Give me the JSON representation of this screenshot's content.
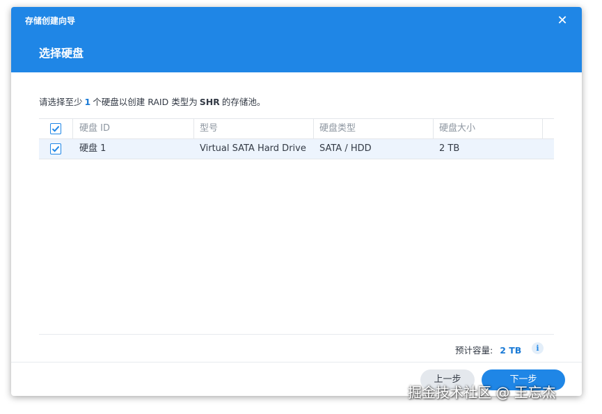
{
  "dialog": {
    "wizard_title": "存储创建向导",
    "step_title": "选择硬盘",
    "close_glyph": "✕",
    "colors": {
      "header": "#1f86e6",
      "accent": "#1a7ad6",
      "row_selected": "#edf4fd"
    }
  },
  "instruction": {
    "part1": "请选择至少",
    "count": "1",
    "part2": "个硬盘以创建 RAID 类型为",
    "raid_type": "SHR",
    "part3": "的存储池。"
  },
  "table": {
    "columns": [
      "硬盘 ID",
      "型号",
      "硬盘类型",
      "硬盘大小"
    ],
    "rows": [
      {
        "checked": true,
        "id": "硬盘 1",
        "model": "Virtual SATA Hard Drive",
        "type": "SATA / HDD",
        "size": "2 TB"
      }
    ]
  },
  "footer": {
    "capacity_label": "预计容量:",
    "capacity_value": "2 TB",
    "info_glyph": "i",
    "prev_label": "上一步",
    "next_label": "下一步"
  },
  "watermark": "掘金技术社区 @ 王忘杰"
}
